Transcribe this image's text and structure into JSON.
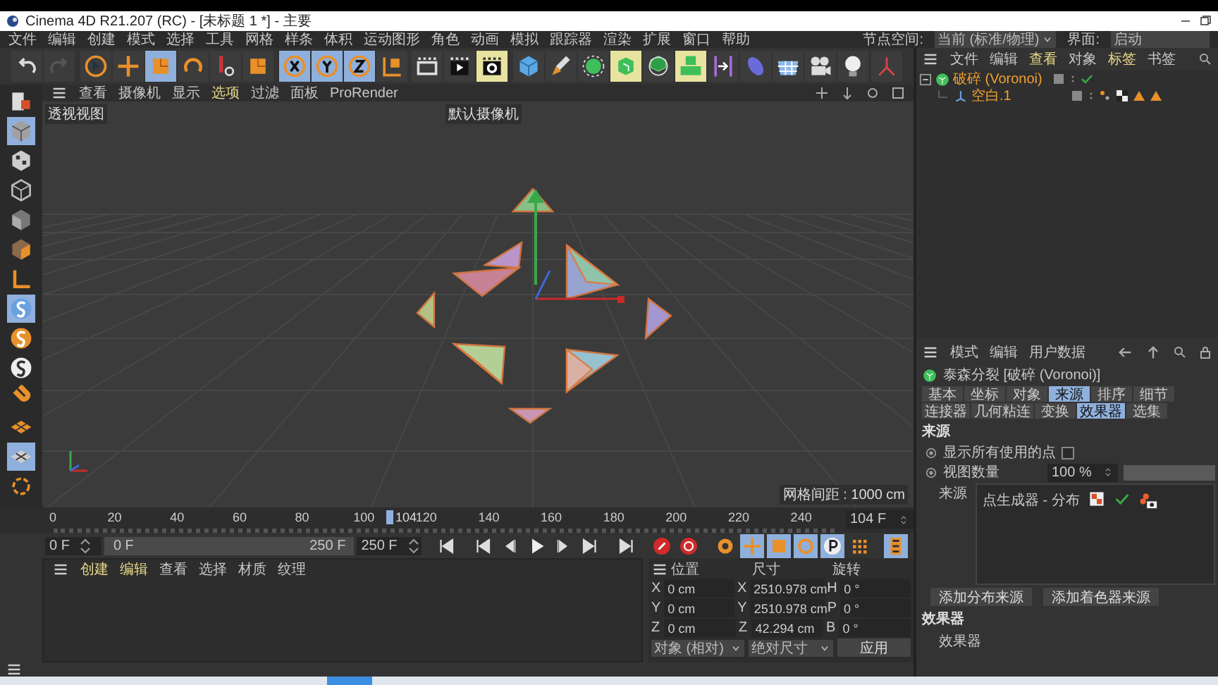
{
  "window": {
    "title": "Cinema 4D R21.207 (RC) - [未标题 1 *] - 主要"
  },
  "menu_bar": {
    "items": [
      {
        "label": "文件"
      },
      {
        "label": "编辑"
      },
      {
        "label": "创建"
      },
      {
        "label": "模式"
      },
      {
        "label": "选择"
      },
      {
        "label": "工具"
      },
      {
        "label": "网格"
      },
      {
        "label": "样条"
      },
      {
        "label": "体积"
      },
      {
        "label": "运动图形"
      },
      {
        "label": "角色"
      },
      {
        "label": "动画"
      },
      {
        "label": "模拟"
      },
      {
        "label": "跟踪器"
      },
      {
        "label": "渲染"
      },
      {
        "label": "扩展"
      },
      {
        "label": "窗口"
      },
      {
        "label": "帮助"
      }
    ],
    "node_space_label": "节点空间:",
    "node_space_value": "当前 (标准/物理)",
    "layout_label": "界面:",
    "layout_value": "启动"
  },
  "viewport": {
    "menu": [
      {
        "label": "查看",
        "highlighted": false
      },
      {
        "label": "摄像机",
        "highlighted": false
      },
      {
        "label": "显示",
        "highlighted": false
      },
      {
        "label": "选项",
        "highlighted": true
      },
      {
        "label": "过滤",
        "highlighted": false
      },
      {
        "label": "面板",
        "highlighted": false
      },
      {
        "label": "ProRender",
        "highlighted": false
      }
    ],
    "view_name": "透视视图",
    "camera": "默认摄像机",
    "grid_spacing": "网格间距 : 1000 cm"
  },
  "timeline": {
    "ticks": [
      "0",
      "20",
      "40",
      "60",
      "80",
      "100",
      "120",
      "140",
      "160",
      "180",
      "200",
      "220",
      "240"
    ],
    "playhead": {
      "label": "104",
      "level": 0.416
    },
    "current_frame": "104 F"
  },
  "playback": {
    "start_field": "0 F",
    "range": {
      "start": "0 F",
      "end": "250 F",
      "level": 1
    },
    "end_field": "250 F"
  },
  "material_manager": {
    "menu": [
      {
        "label": "创建",
        "highlighted": true
      },
      {
        "label": "编辑",
        "highlighted": true
      },
      {
        "label": "查看",
        "highlighted": false
      },
      {
        "label": "选择",
        "highlighted": false
      },
      {
        "label": "材质",
        "highlighted": false
      },
      {
        "label": "纹理",
        "highlighted": false
      }
    ]
  },
  "coordinates": {
    "headers": [
      "位置",
      "尺寸",
      "旋转"
    ],
    "rows": [
      {
        "axis_pos": "X",
        "position": "0 cm",
        "axis_size": "X",
        "size": "2510.978 cm",
        "axis_rot": "H",
        "rotation": "0 °"
      },
      {
        "axis_pos": "Y",
        "position": "0 cm",
        "axis_size": "Y",
        "size": "2510.978 cm",
        "axis_rot": "P",
        "rotation": "0 °"
      },
      {
        "axis_pos": "Z",
        "position": "0 cm",
        "axis_size": "Z",
        "size": "42.294 cm",
        "axis_rot": "B",
        "rotation": "0 °"
      }
    ],
    "mode_dropdown": "对象 (相对)",
    "size_dropdown": "绝对尺寸",
    "apply_button": "应用"
  },
  "object_manager": {
    "menu": [
      {
        "label": "文件",
        "highlighted": false
      },
      {
        "label": "编辑",
        "highlighted": false
      },
      {
        "label": "查看",
        "highlighted": true
      },
      {
        "label": "对象",
        "highlighted": false
      },
      {
        "label": "标签",
        "highlighted": true
      },
      {
        "label": "书签",
        "highlighted": false
      }
    ],
    "objects": [
      {
        "name": "破碎 (Voronoi)",
        "selected": true,
        "expanded": true,
        "children": [
          {
            "name": "空白.1",
            "selected": true
          }
        ]
      }
    ]
  },
  "attributes": {
    "menu": [
      {
        "label": "模式"
      },
      {
        "label": "编辑"
      },
      {
        "label": "用户数据"
      }
    ],
    "title": "泰森分裂 [破碎 (Voronoi)]",
    "tabs": [
      {
        "label": "基本",
        "selected": false
      },
      {
        "label": "坐标",
        "selected": false
      },
      {
        "label": "对象",
        "selected": false
      },
      {
        "label": "来源",
        "selected": true
      },
      {
        "label": "排序",
        "selected": false
      },
      {
        "label": "细节",
        "selected": false
      },
      {
        "label": "连接器",
        "selected": false
      },
      {
        "label": "几何粘连",
        "selected": false
      },
      {
        "label": "变换",
        "selected": false
      },
      {
        "label": "效果器",
        "selected": true
      },
      {
        "label": "选集",
        "selected": false
      }
    ],
    "section": "来源",
    "options": [
      {
        "kind": "checkbox",
        "label": "显示所有使用的点",
        "checked": false
      },
      {
        "kind": "number",
        "label": "视图数量",
        "value": "100 %",
        "level": 1
      }
    ],
    "source_list": {
      "label": "来源",
      "items": [
        {
          "name": "点生成器 - 分布",
          "enabled": true
        }
      ]
    },
    "buttons": [
      "添加分布来源",
      "添加着色器来源"
    ],
    "effectors_section": "效果器",
    "effectors_label": "效果器"
  }
}
